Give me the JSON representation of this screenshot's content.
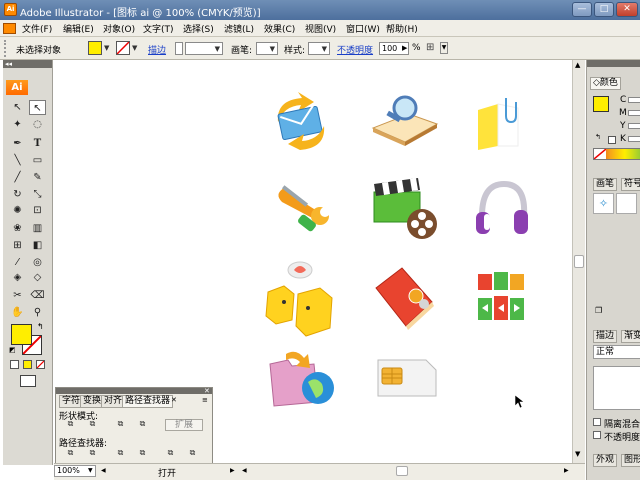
{
  "window": {
    "title": "Adobe Illustrator - [图标 ai @ 100% (CMYK/预览)]",
    "app_icon_label": "Ai",
    "minimize_label": "—",
    "maximize_label": "□",
    "close_label": "✕"
  },
  "menu": {
    "items": [
      "文件(F)",
      "编辑(E)",
      "对象(O)",
      "文字(T)",
      "选择(S)",
      "滤镜(L)",
      "效果(C)",
      "视图(V)",
      "窗口(W)",
      "帮助(H)"
    ]
  },
  "control": {
    "selection_label": "未选择对象",
    "stroke_link": "描边",
    "brush_label": "画笔:",
    "style_label": "样式:",
    "opacity_link": "不透明度",
    "opacity_value": "100",
    "opacity_unit": "%",
    "fill_color": "#ffee00"
  },
  "tools": {
    "logo": "Ai",
    "fill_color": "#ffee00"
  },
  "pathfinder": {
    "tabs": [
      "字符",
      "变换",
      "对齐",
      "路径查找器"
    ],
    "shape_modes_label": "形状模式:",
    "expand_label": "扩展",
    "pathfinders_label": "路径查找器:"
  },
  "status": {
    "zoom": "100%",
    "open_label": "打开"
  },
  "panels": {
    "color_tab": "颜色",
    "color_channels": [
      "C",
      "M",
      "Y",
      "K"
    ],
    "brush_tab": "画笔",
    "symbol_tab": "符号",
    "stroke_tab": "描边",
    "gradient_tab": "渐变",
    "blend_mode": "正常",
    "isolate_blend": "隔离混合",
    "knockout_opacity": "不透明度",
    "appearance_tab": "外观",
    "graphic_styles_tab": "图形"
  }
}
